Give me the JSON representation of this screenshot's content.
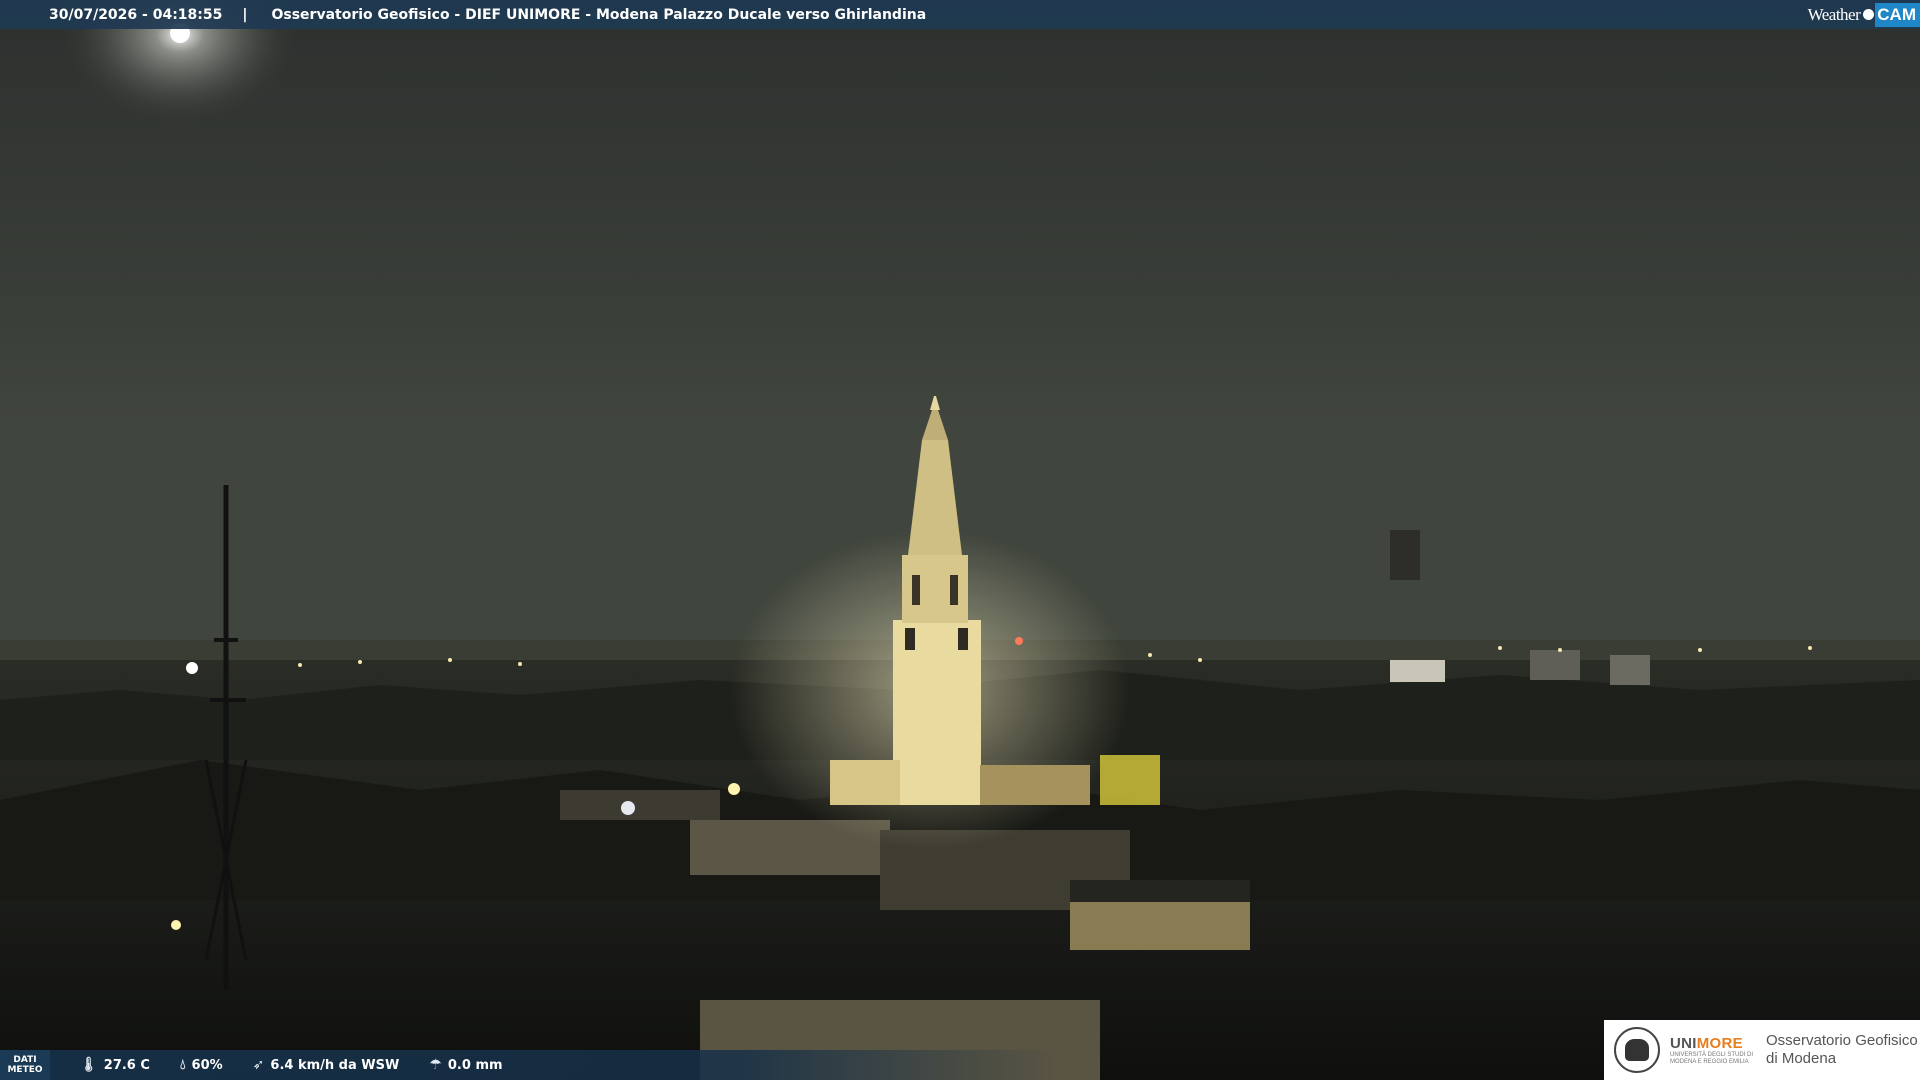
{
  "topbar": {
    "datetime": "30/07/2026 - 04:18:55",
    "separator": "|",
    "title": "Osservatorio Geofisico - DIEF UNIMORE - Modena Palazzo Ducale verso Ghirlandina"
  },
  "brand": {
    "weather": "Weather",
    "cam": "CAM"
  },
  "weather": {
    "badge_line1": "DATI",
    "badge_line2": "METEO",
    "temperature": "27.6 C",
    "humidity": "60%",
    "wind": "6.4 km/h da WSW",
    "rain": "0.0 mm",
    "icons": {
      "temperature": "thermometer-icon",
      "humidity": "droplet-icon",
      "wind": "wind-icon",
      "rain": "rain-gauge-icon"
    }
  },
  "logo": {
    "uni": "UNI",
    "more": "MORE",
    "uni_sub": "UNIVERSITÀ DEGLI STUDI DI MODENA E REGGIO EMILIA",
    "obs_line1": "Osservatorio Geofisico",
    "obs_line2": "di Modena"
  },
  "colors": {
    "bar": "#1e3a52",
    "cam_accent": "#1f86c7",
    "unimore_orange": "#e67e22"
  }
}
